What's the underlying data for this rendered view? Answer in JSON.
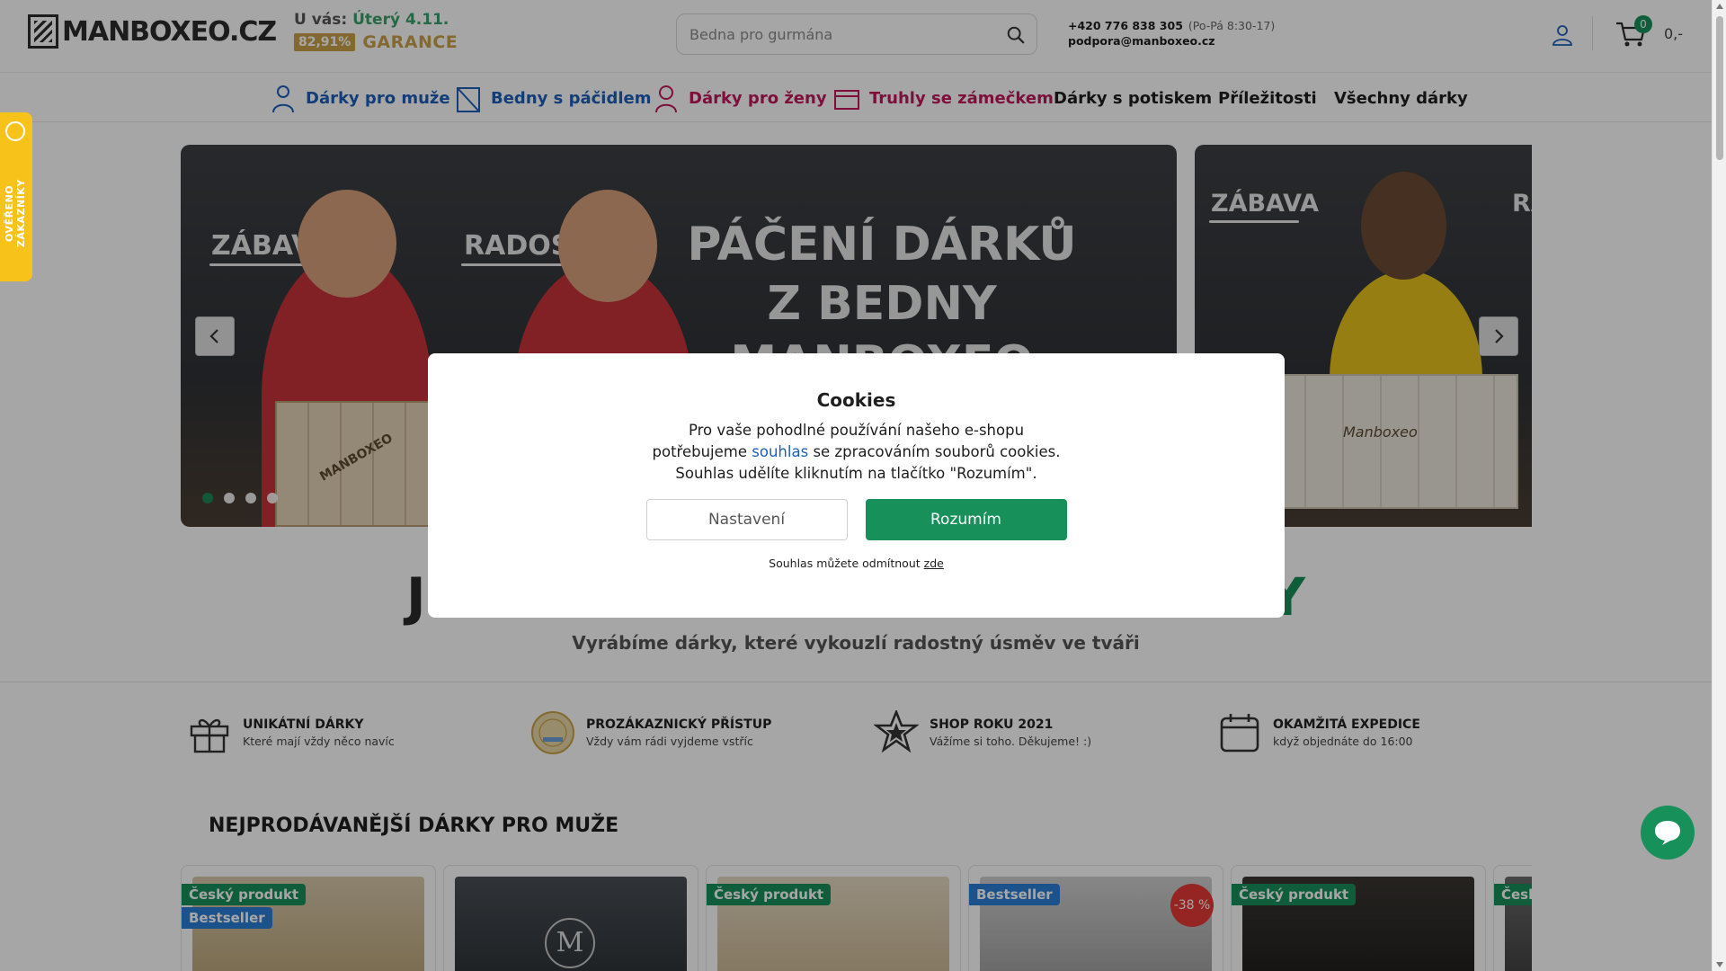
{
  "header": {
    "logo_text": "MANBOXEO.CZ",
    "delivery_label": "U vás:",
    "delivery_day": "Úterý 4.11.",
    "delivery_percent": "82,91%",
    "guarantee": "GARANCE",
    "search_placeholder": "Bedna pro gurmána",
    "phone": "+420 776 838 305",
    "hours": "(Po-Pá 8:30-17)",
    "email": "podpora@manboxeo.cz",
    "cart_count": "0",
    "cart_total": "0,-"
  },
  "nav": {
    "items": [
      {
        "label": "Dárky pro muže",
        "color": "#1d5fb8"
      },
      {
        "label": "Bedny s páčidlem",
        "color": "#1d5fb8"
      },
      {
        "label": "Dárky pro ženy",
        "color": "#c2185b"
      },
      {
        "label": "Truhly se zámečkem",
        "color": "#c2185b"
      },
      {
        "label": "Dárky s potiskem",
        "color": "#1e1e1e"
      },
      {
        "label": "Příležitosti",
        "color": "#1e1e1e"
      },
      {
        "label": "Všechny dárky",
        "color": "#1e1e1e"
      }
    ]
  },
  "banner": {
    "slide1_words": [
      "ZÁBAVA",
      "RADOST"
    ],
    "slide1_title": [
      "PÁČENÍ DÁRKŮ",
      "Z BEDNY",
      "MANBOXEO"
    ],
    "slide2_words": [
      "ZÁBAVA",
      "RA"
    ],
    "crate_brand": "MANBOXEO",
    "crate2_brand": "Manboxeo",
    "active_slide": 1,
    "slides_count": 4
  },
  "headline": {
    "left_visible": "J",
    "right_visible": "Y",
    "subline": "Vyrábíme dárky, které vykouzlí radostný úsměv ve tváři"
  },
  "usps": [
    {
      "title": "UNIKÁTNÍ DÁRKY",
      "desc": "Které mají vždy něco navíc",
      "icon": "gift-icon"
    },
    {
      "title": "PROZÁKAZNICKÝ PŘÍSTUP",
      "desc": "Vždy vám rádi vyjdeme vstříc",
      "icon": "heureka-verified-icon"
    },
    {
      "title": "SHOP ROKU 2021",
      "desc": "Vážíme si toho. Děkujeme! :)",
      "icon": "star-award-icon"
    },
    {
      "title": "OKAMŽITÁ EXPEDICE",
      "desc": "když objednáte do 16:00",
      "icon": "calendar-icon"
    }
  ],
  "section_title": "NEJPRODÁVANĚJŠÍ DÁRKY PRO MUŽE",
  "products": [
    {
      "badges": [
        {
          "text": "Český produkt",
          "type": "green"
        },
        {
          "text": "Bestseller",
          "type": "blue"
        }
      ],
      "discount": ""
    },
    {
      "badges": [],
      "discount": ""
    },
    {
      "badges": [
        {
          "text": "Český produkt",
          "type": "green"
        }
      ],
      "discount": ""
    },
    {
      "badges": [
        {
          "text": "Bestseller",
          "type": "blue"
        }
      ],
      "discount": "-38 %"
    },
    {
      "badges": [
        {
          "text": "Český produkt",
          "type": "green"
        }
      ],
      "discount": ""
    },
    {
      "badges": [
        {
          "text": "Česk",
          "type": "green"
        }
      ],
      "discount": ""
    }
  ],
  "cookies": {
    "title": "Cookies",
    "line1": "Pro vaše pohodlné používání našeho e-shopu",
    "line2_pre": "potřebujeme",
    "line2_link": "souhlas",
    "line2_post": "se zpracováním souborů cookies.",
    "line3": "Souhlas udělíte kliknutím na tlačítko \"Rozumím\".",
    "settings_label": "Nastavení",
    "accept_label": "Rozumím",
    "reject_pre": "Souhlas můžete odmítnout",
    "reject_link": "zde"
  },
  "side_tab": {
    "label": "OVĚŘENO ZÁKAZNÍKY"
  },
  "colors": {
    "brand_green": "#17905a",
    "gold": "#caa24a",
    "men_blue": "#1d5fb8",
    "women_pink": "#c2185b",
    "sidebar_yellow": "#f7c31a"
  }
}
